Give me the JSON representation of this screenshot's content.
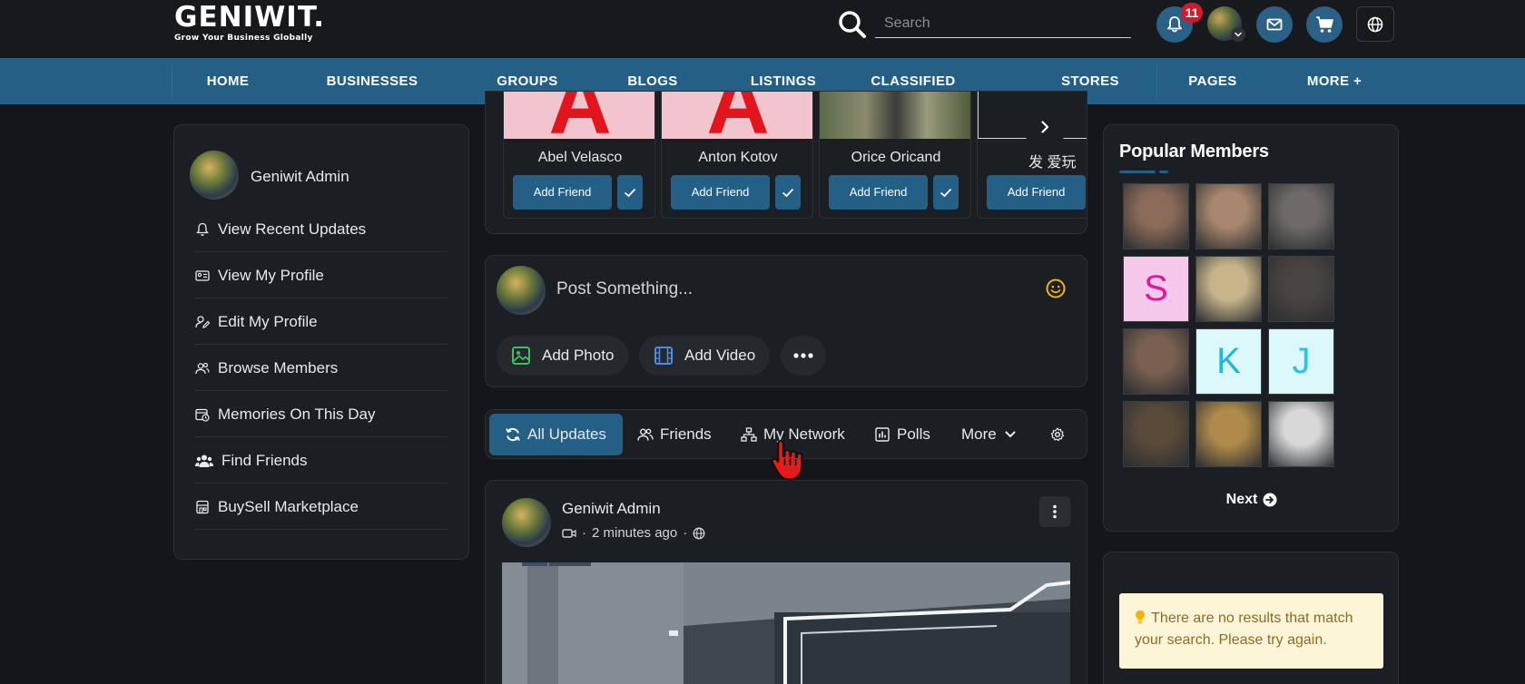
{
  "header": {
    "logo_title": "GENIWIT.",
    "logo_tagline": "Grow Your Business Globally",
    "search_placeholder": "Search",
    "notification_count": "11"
  },
  "nav": {
    "items": [
      "HOME",
      "BUSINESSES",
      "GROUPS",
      "BLOGS",
      "LISTINGS",
      "CLASSIFIED",
      "STORES",
      "PAGES",
      "MORE +"
    ]
  },
  "left_sidebar": {
    "user_name": "Geniwit Admin",
    "items": [
      {
        "label": "View Recent Updates",
        "icon": "bell-icon"
      },
      {
        "label": "View My Profile",
        "icon": "id-card-icon"
      },
      {
        "label": "Edit My Profile",
        "icon": "user-edit-icon"
      },
      {
        "label": "Browse Members",
        "icon": "users-icon"
      },
      {
        "label": "Memories On This Day",
        "icon": "calendar-clock-icon"
      },
      {
        "label": "Find Friends",
        "icon": "user-group-icon"
      },
      {
        "label": "BuySell Marketplace",
        "icon": "store-icon"
      }
    ]
  },
  "friend_suggestions": {
    "add_label": "Add Friend",
    "people": [
      {
        "name": "Abel Velasco",
        "avatar_letter": "A"
      },
      {
        "name": "Anton Kotov",
        "avatar_letter": "A"
      },
      {
        "name": "Orice Oricand",
        "avatar_letter": ""
      },
      {
        "name": "发 爱玩",
        "avatar_letter": ""
      }
    ]
  },
  "composer": {
    "placeholder": "Post Something...",
    "add_photo": "Add Photo",
    "add_video": "Add Video"
  },
  "feed_filters": {
    "items": [
      "All Updates",
      "Friends",
      "My Network",
      "Polls",
      "More"
    ],
    "active": "All Updates"
  },
  "post": {
    "author": "Geniwit Admin",
    "time": "2 minutes ago"
  },
  "popular_members": {
    "title": "Popular Members",
    "next_label": "Next",
    "members": [
      {
        "type": "photo",
        "tone": "#8a6a58"
      },
      {
        "type": "photo",
        "tone": "#a8876e"
      },
      {
        "type": "photo",
        "tone": "#6e6a66"
      },
      {
        "type": "letter",
        "letter": "S",
        "bg": "#f6c8ec",
        "color": "#e0189a"
      },
      {
        "type": "photo",
        "tone": "#c8b48a"
      },
      {
        "type": "photo",
        "tone": "#4a4440"
      },
      {
        "type": "photo",
        "tone": "#7a6050"
      },
      {
        "type": "letter",
        "letter": "K",
        "bg": "#dcf8fb",
        "color": "#1fb8d8"
      },
      {
        "type": "letter",
        "letter": "J",
        "bg": "#dcf8fb",
        "color": "#26c6de"
      },
      {
        "type": "photo",
        "tone": "#5a4a3a"
      },
      {
        "type": "photo",
        "tone": "#b08a4a"
      },
      {
        "type": "photo",
        "tone": "#d8d8d8"
      }
    ]
  },
  "search_results": {
    "message": "There are no results that match your search. Please try again."
  },
  "colors": {
    "accent": "#245f86",
    "background": "#141619",
    "card": "#1b1e22",
    "badge": "#d11a2a"
  }
}
